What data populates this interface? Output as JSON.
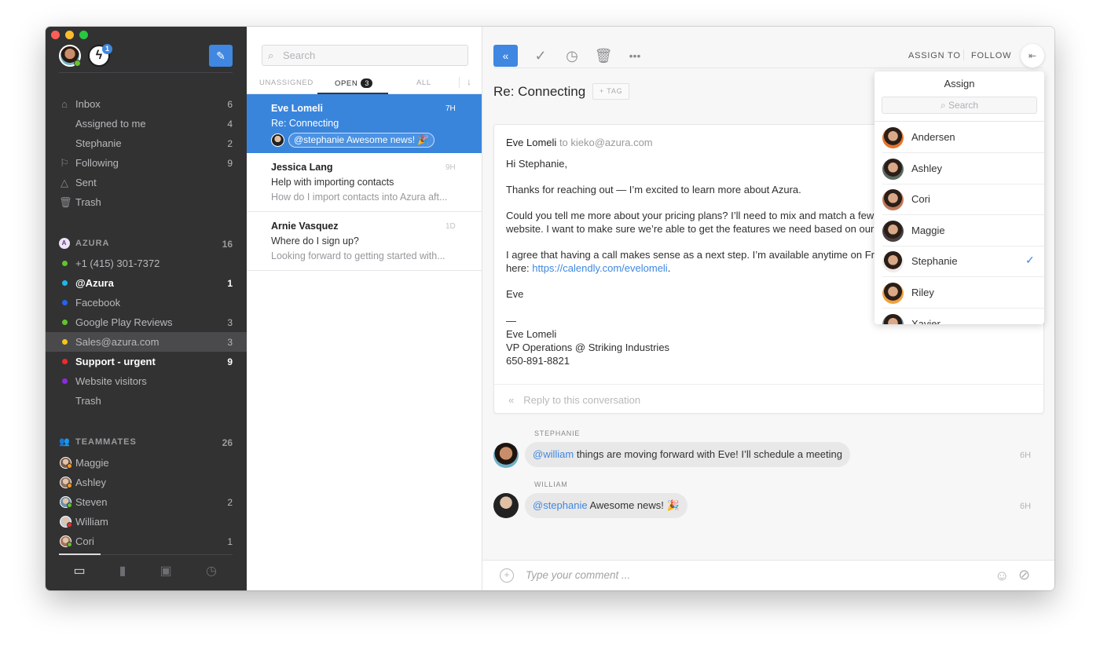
{
  "sidebar": {
    "bolt_badge": "1",
    "compose_icon": "pencil-icon",
    "nav": [
      {
        "label": "Inbox",
        "count": "6",
        "icon": "home-icon"
      },
      {
        "label": "Assigned to me",
        "count": "4"
      },
      {
        "label": "Stephanie",
        "count": "2"
      },
      {
        "label": "Following",
        "count": "9",
        "icon": "bookmark-icon"
      },
      {
        "label": "Sent",
        "count": "",
        "icon": "sent-icon"
      },
      {
        "label": "Trash",
        "count": "",
        "icon": "trash-icon"
      }
    ],
    "azura": {
      "initial": "A",
      "title": "AZURA",
      "count": "16",
      "channels": [
        {
          "label": "+1 (415) 301-7372",
          "count": "",
          "color": "#62c32a",
          "bold": false
        },
        {
          "label": "@Azura",
          "count": "1",
          "color": "#1fb5ee",
          "bold": true
        },
        {
          "label": "Facebook",
          "count": "",
          "color": "#2563eb",
          "bold": false
        },
        {
          "label": "Google Play Reviews",
          "count": "3",
          "color": "#62c32a",
          "bold": false
        },
        {
          "label": "Sales@azura.com",
          "count": "3",
          "color": "#f5c518",
          "bold": false,
          "selected": true
        },
        {
          "label": "Support - urgent",
          "count": "9",
          "color": "#ef2a2a",
          "bold": true
        },
        {
          "label": "Website visitors",
          "count": "",
          "color": "#8a2be2",
          "bold": false
        },
        {
          "label": "Trash",
          "count": "",
          "color": "",
          "bold": false
        }
      ]
    },
    "teammates": {
      "title": "TEAMMATES",
      "count": "26",
      "members": [
        {
          "name": "Maggie",
          "count": "",
          "status": "#f39a1e"
        },
        {
          "name": "Ashley",
          "count": "",
          "status": "#f39a1e"
        },
        {
          "name": "Steven",
          "count": "2",
          "status": "#62c32a"
        },
        {
          "name": "William",
          "count": "",
          "status": "#ef2a2a"
        },
        {
          "name": "Cori",
          "count": "1",
          "status": "#62c32a"
        }
      ]
    },
    "footer_icons": [
      "inbox-tray-icon",
      "analytics-icon",
      "contacts-icon",
      "scheduled-icon"
    ]
  },
  "list": {
    "search_placeholder": "Search",
    "tabs": {
      "unassigned": "UNASSIGNED",
      "open": "OPEN",
      "open_count": "3",
      "all": "ALL"
    },
    "conversations": [
      {
        "name": "Eve Lomeli",
        "time": "7H",
        "subject": "Re: Connecting",
        "preview": "@stephanie Awesome news! 🎉",
        "selected": true
      },
      {
        "name": "Jessica Lang",
        "time": "9H",
        "subject": "Help with importing contacts",
        "preview": "How do I import contacts into Azura aft..."
      },
      {
        "name": "Arnie Vasquez",
        "time": "1D",
        "subject": "Where do I sign up?",
        "preview": "Looking forward to getting started with..."
      }
    ]
  },
  "main": {
    "toolbar": {
      "assign_to": "ASSIGN TO",
      "follow": "FOLLOW"
    },
    "subject": "Re: Connecting",
    "tag_label": "+ TAG",
    "message": {
      "from": "Eve Lomeli",
      "to": "to kieko@azura.com",
      "greeting": "Hi Stephanie,",
      "p1": "Thanks for reaching out — I’m excited to learn more about Azura.",
      "p2a": "Could you tell me more about your pricing plans? I’ll need to mix and match a few op",
      "p2b": "website. I want to make sure we’re able to get the features we need based on our cu",
      "p3a": "I agree that having a call makes sense as a next step. I’m available anytime on Frida",
      "p3b_prefix": "here: ",
      "p3b_link": "https://calendly.com/evelomeli",
      "p3b_suffix": ".",
      "signoff": "Eve",
      "dash": "—",
      "sig_name": "Eve Lomeli",
      "sig_title": "VP Operations @ Striking Industries",
      "sig_phone": "650-891-8821",
      "reply_placeholder": "Reply to this conversation"
    },
    "comments": [
      {
        "author": "STEPHANIE",
        "mention": "@william",
        "text": " things are moving forward with Eve! I’ll schedule a meeting",
        "time": "6H"
      },
      {
        "author": "WILLIAM",
        "mention": "@stephanie",
        "text": " Awesome news! 🎉",
        "time": "6H"
      }
    ],
    "composer_placeholder": "Type your comment ..."
  },
  "assign_dropdown": {
    "title": "Assign",
    "search_placeholder": "Search",
    "people": [
      {
        "name": "Andersen",
        "checked": false
      },
      {
        "name": "Ashley",
        "checked": false
      },
      {
        "name": "Cori",
        "checked": false
      },
      {
        "name": "Maggie",
        "checked": false
      },
      {
        "name": "Stephanie",
        "checked": true
      },
      {
        "name": "Riley",
        "checked": false
      },
      {
        "name": "Xavier",
        "checked": false
      }
    ]
  }
}
